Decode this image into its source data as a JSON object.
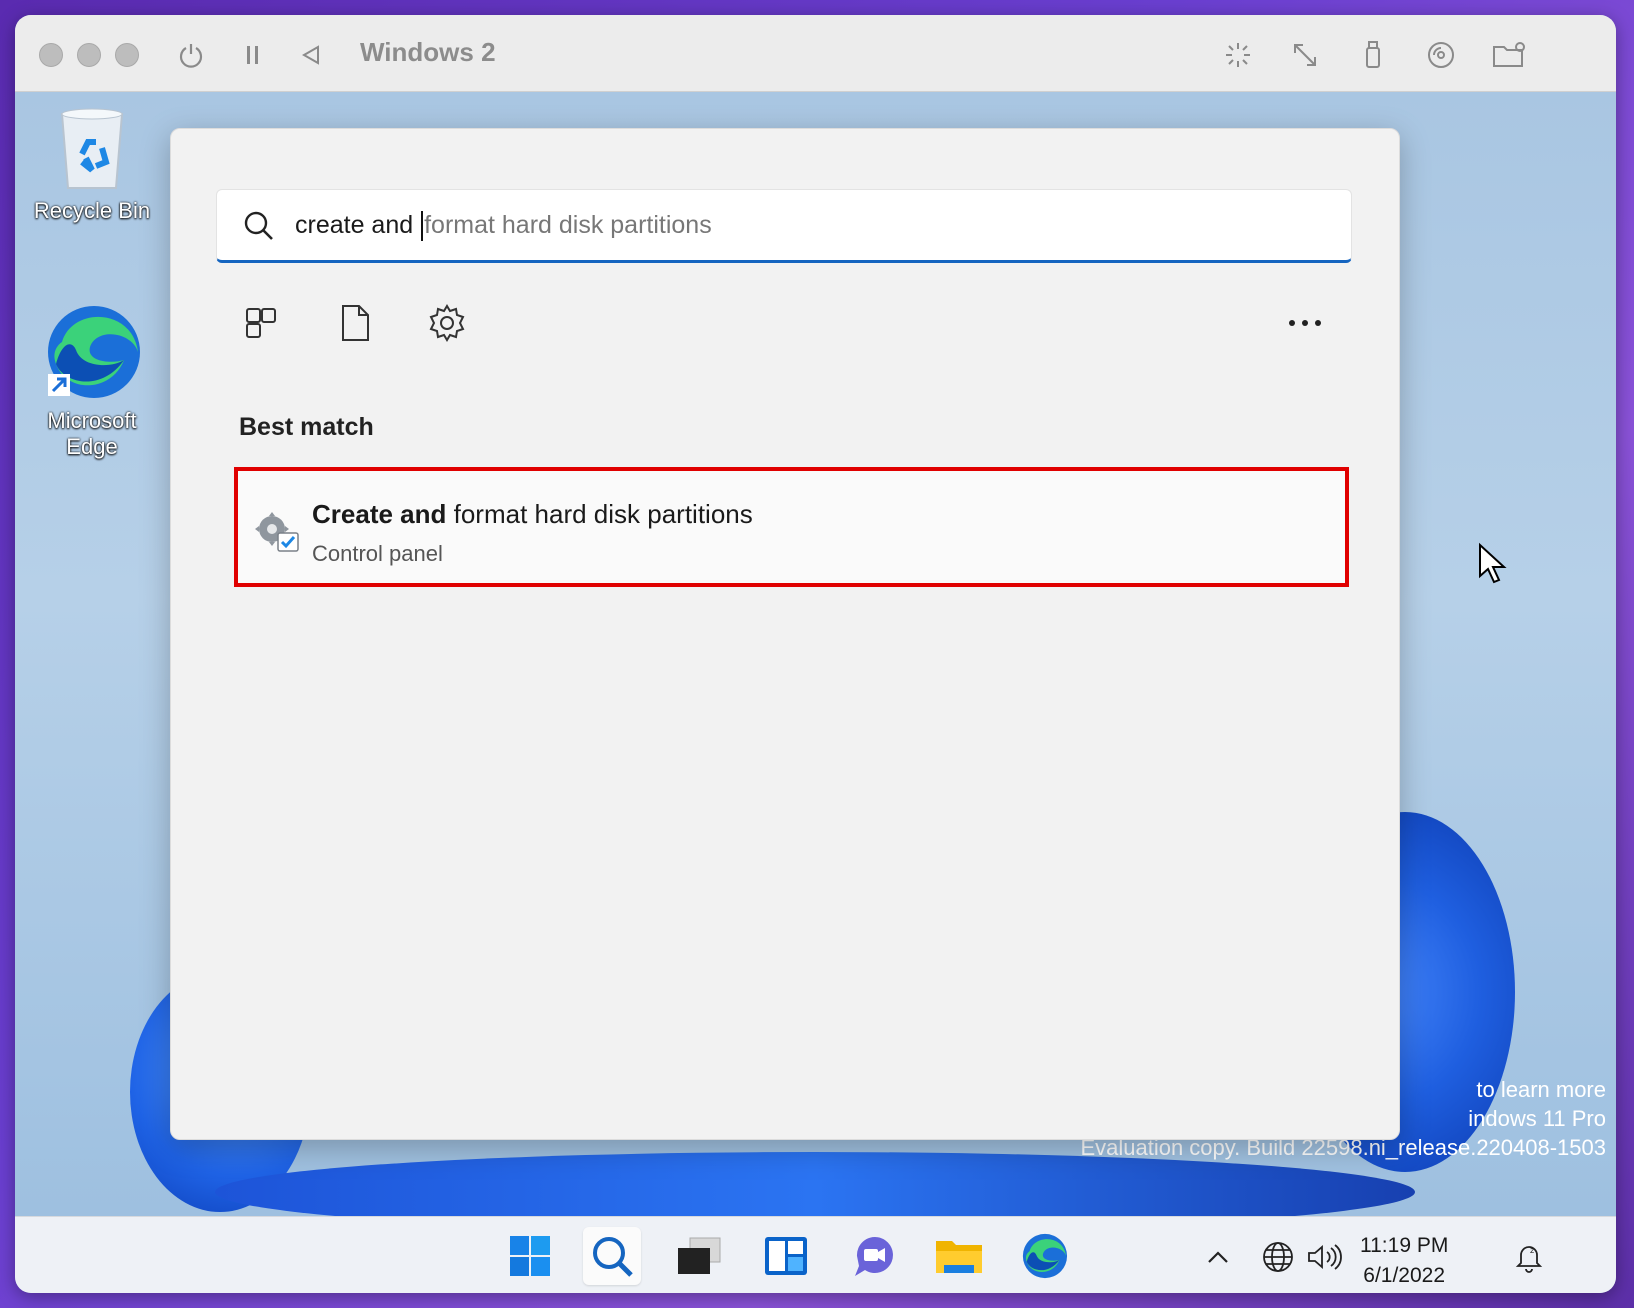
{
  "vm_window": {
    "title": "Windows 2"
  },
  "desktop": {
    "icons": [
      {
        "label": "Recycle Bin"
      },
      {
        "label_line1": "Microsoft",
        "label_line2": "Edge"
      }
    ],
    "watermark": {
      "line1": "to learn more",
      "line2": "indows 11 Pro",
      "line3": "Evaluation copy. Build 22598.ni_release.220408-1503"
    }
  },
  "start": {
    "search": {
      "typed": "create and ",
      "completion": "format hard disk partitions"
    },
    "filters": [
      "apps-filter",
      "documents-filter",
      "settings-filter"
    ],
    "section_heading": "Best match",
    "result": {
      "title_bold": "Create and",
      "title_rest": " format hard disk partitions",
      "subtitle": "Control panel"
    },
    "highlight_color": "#e00000",
    "accent_color": "#1565c0"
  },
  "taskbar": {
    "apps": [
      "start-icon",
      "search-icon",
      "task-view-icon",
      "widgets-icon",
      "teams-chat-icon",
      "file-explorer-icon",
      "edge-icon"
    ],
    "clock": {
      "time": "11:19 PM",
      "date": "6/1/2022"
    }
  }
}
